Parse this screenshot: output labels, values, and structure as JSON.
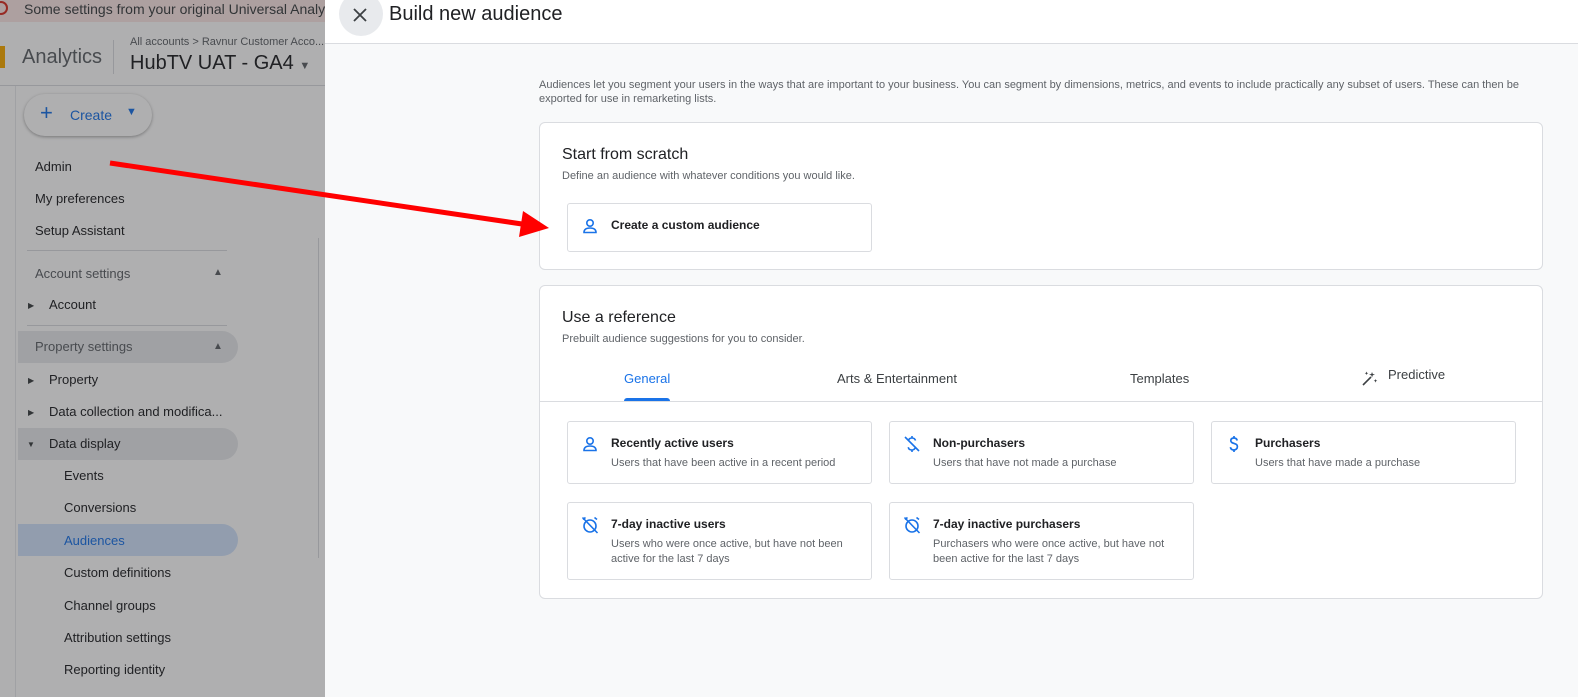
{
  "background": {
    "banner_text": "Some settings from your original Universal Analytics",
    "app_name": "Analytics",
    "breadcrumb": "All accounts > Ravnur Customer Acco...",
    "property_name": "HubTV UAT - GA4",
    "create_label": "Create",
    "nav": {
      "admin": "Admin",
      "my_preferences": "My preferences",
      "setup_assistant": "Setup Assistant",
      "account_settings": "Account settings",
      "account": "Account",
      "property_settings": "Property settings",
      "property": "Property",
      "data_collection": "Data collection and modifica...",
      "data_display": "Data display",
      "events": "Events",
      "conversions": "Conversions",
      "audiences": "Audiences",
      "custom_definitions": "Custom definitions",
      "channel_groups": "Channel groups",
      "attribution_settings": "Attribution settings",
      "reporting_identity": "Reporting identity"
    }
  },
  "panel": {
    "title": "Build new audience",
    "intro": "Audiences let you segment your users in the ways that are important to your business. You can segment by dimensions, metrics, and events to include practically any subset of users. These can then be exported for use in remarketing lists.",
    "scratch": {
      "title": "Start from scratch",
      "subtitle": "Define an audience with whatever conditions you would like.",
      "custom_label": "Create a custom audience"
    },
    "reference": {
      "title": "Use a reference",
      "subtitle": "Prebuilt audience suggestions for you to consider.",
      "tabs": {
        "general": "General",
        "arts": "Arts & Entertainment",
        "templates": "Templates",
        "predictive": "Predictive"
      },
      "options": [
        {
          "title": "Recently active users",
          "desc": "Users that have been active in a recent period",
          "icon": "person-icon"
        },
        {
          "title": "Non-purchasers",
          "desc": "Users that have not made a purchase",
          "icon": "money-off-icon"
        },
        {
          "title": "Purchasers",
          "desc": "Users that have made a purchase",
          "icon": "dollar-icon"
        },
        {
          "title": "7-day inactive users",
          "desc": "Users who were once active, but have not been active for the last 7 days",
          "icon": "alarm-off-icon"
        },
        {
          "title": "7-day inactive purchasers",
          "desc": "Purchasers who were once active, but have not been active for the last 7 days",
          "icon": "alarm-off-icon"
        }
      ]
    }
  },
  "colors": {
    "accent": "#1a73e8",
    "annotation_arrow": "#ff0000"
  }
}
